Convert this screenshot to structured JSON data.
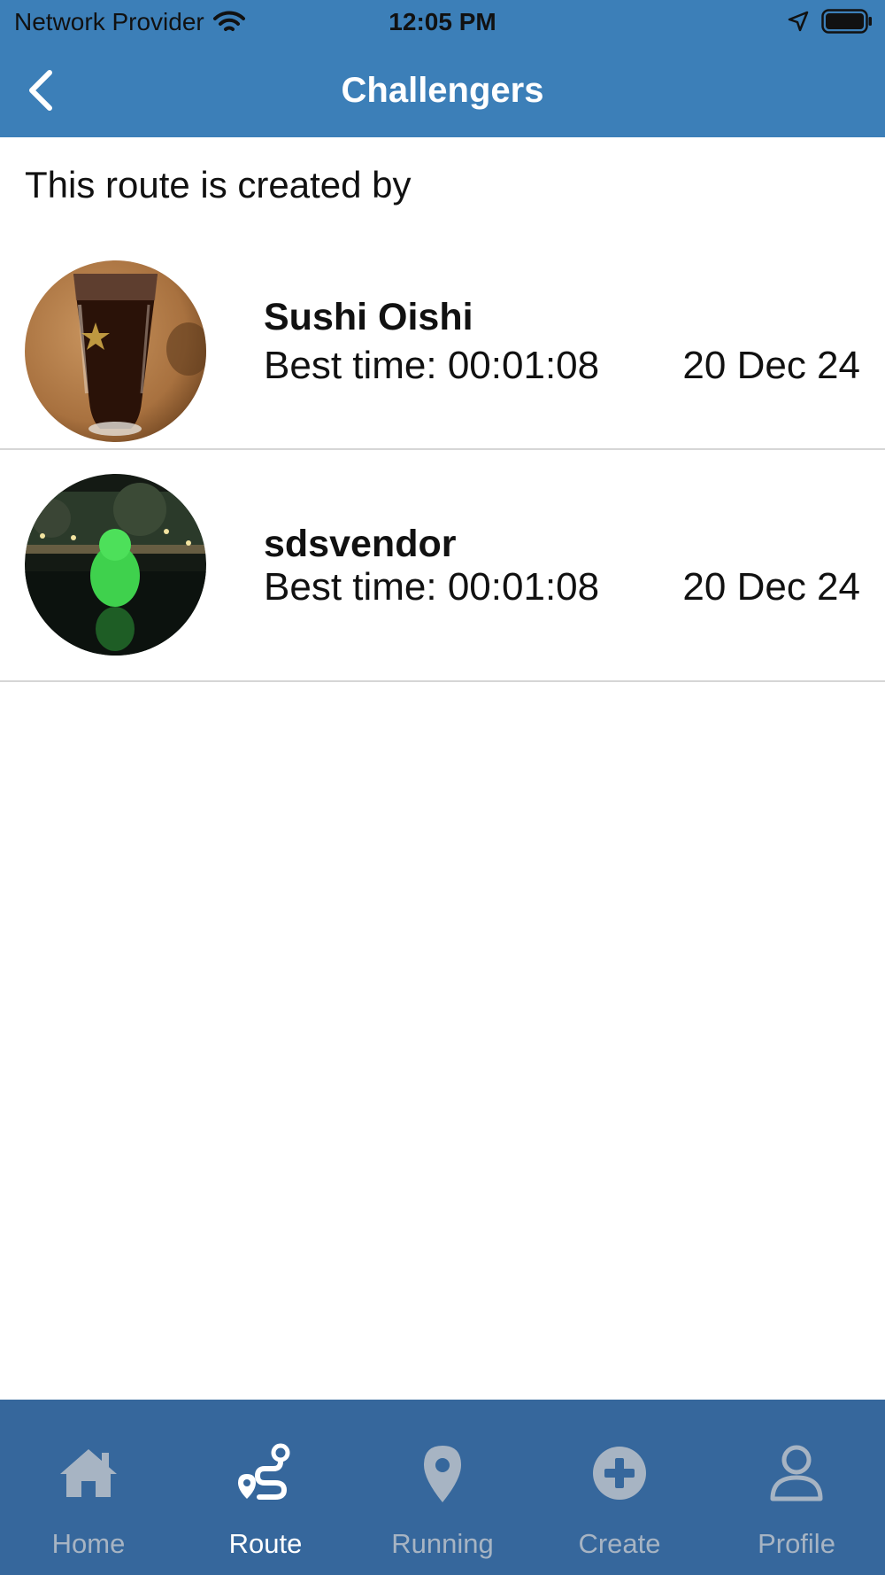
{
  "status_bar": {
    "carrier": "Network Provider",
    "time": "12:05 PM"
  },
  "nav": {
    "title": "Challengers"
  },
  "intro_text": "This route is created by",
  "challengers": [
    {
      "name": "Sushi  Oishi",
      "best_time": "Best time: 00:01:08",
      "date": "20 Dec 24"
    },
    {
      "name": "sdsvendor",
      "best_time": "Best time: 00:01:08",
      "date": "20 Dec 24"
    }
  ],
  "tabs": [
    {
      "label": "Home",
      "icon": "home-icon",
      "active": false
    },
    {
      "label": "Route",
      "icon": "route-icon",
      "active": true
    },
    {
      "label": "Running",
      "icon": "location-pin-icon",
      "active": false
    },
    {
      "label": "Create",
      "icon": "plus-circle-icon",
      "active": false
    },
    {
      "label": "Profile",
      "icon": "user-icon",
      "active": false
    }
  ],
  "colors": {
    "header": "#3c7fb8",
    "tab_bar": "#36679c",
    "tab_inactive": "#a7b4c3",
    "tab_active": "#ffffff"
  }
}
